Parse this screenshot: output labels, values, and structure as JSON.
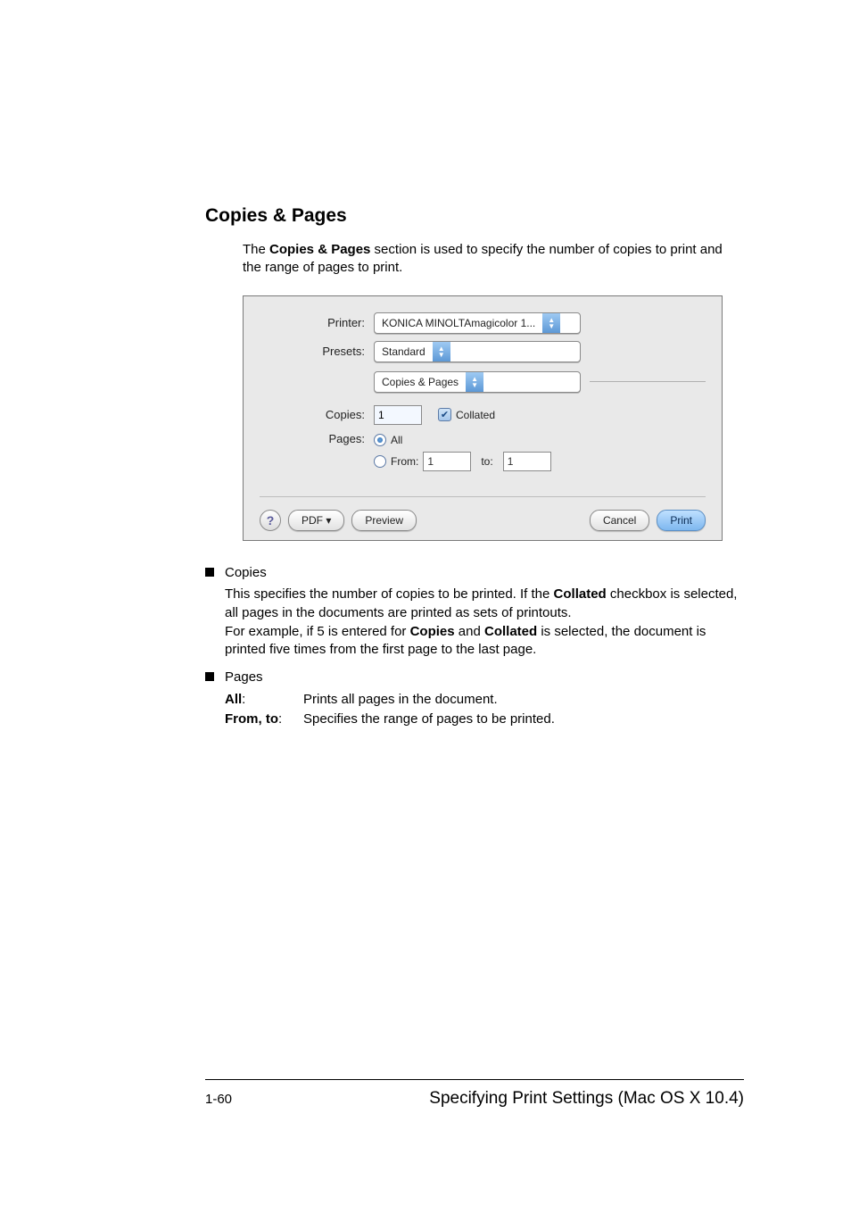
{
  "heading": "Copies & Pages",
  "intro": {
    "prefix": "The ",
    "bold1": "Copies & Pages",
    "rest": " section is used to specify the number of copies to print and the range of pages to print."
  },
  "dialog": {
    "printer_label": "Printer:",
    "printer_value": "KONICA MINOLTAmagicolor 1...",
    "presets_label": "Presets:",
    "presets_value": "Standard",
    "section_value": "Copies & Pages",
    "copies_label": "Copies:",
    "copies_value": "1",
    "collated_label": "Collated",
    "pages_label": "Pages:",
    "pages_all": "All",
    "pages_from": "From:",
    "pages_from_value": "1",
    "pages_to": "to:",
    "pages_to_value": "1",
    "help": "?",
    "pdf_btn": "PDF ▾",
    "preview_btn": "Preview",
    "cancel_btn": "Cancel",
    "print_btn": "Print"
  },
  "bullets": {
    "copies_title": "Copies",
    "copies_body_1": "This specifies the number of copies to be printed. If the ",
    "copies_bold_1": "Collated",
    "copies_body_2": " check­box is selected, all pages in the documents are printed as sets of print­outs.",
    "copies_body_3": "For example, if 5 is entered for ",
    "copies_bold_2": "Copies",
    "copies_body_4": " and ",
    "copies_bold_3": "Collated",
    "copies_body_5": " is selected, the doc­ument is printed five times from the first page to the last page.",
    "pages_title": "Pages",
    "all_key": "All",
    "all_value": "Prints all pages in the document.",
    "fromto_key": "From, to",
    "fromto_value": "Specifies the range of pages to be printed."
  },
  "footer": {
    "page_num": "1-60",
    "right": "Specifying Print Settings (Mac OS X 10.4)"
  }
}
